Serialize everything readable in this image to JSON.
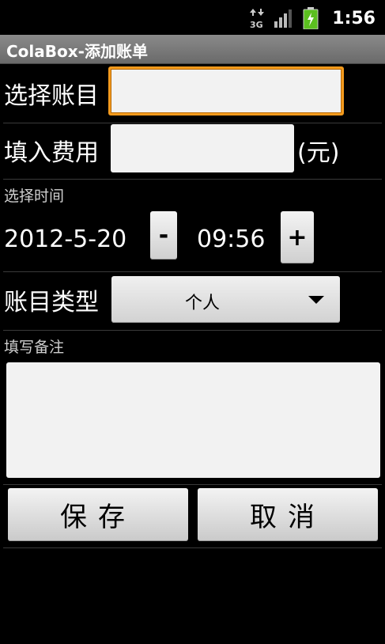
{
  "status": {
    "time": "1:56",
    "network": "3G"
  },
  "app_title": "ColaBox-添加账单",
  "form": {
    "account_label": "选择账目",
    "account_value": "",
    "cost_label": "填入费用",
    "cost_value": "",
    "cost_unit": "(元)",
    "time_label": "选择时间",
    "date_value": "2012-5-20",
    "minus_label": "-",
    "time_value": "09:56",
    "plus_label": "+",
    "type_label": "账目类型",
    "type_value": "个人",
    "note_label": "填写备注",
    "note_value": ""
  },
  "buttons": {
    "save": "保存",
    "cancel": "取消"
  },
  "colors": {
    "focus_border": "#f39a1d",
    "titlebar": "#7a7a7a",
    "background": "#000000"
  }
}
